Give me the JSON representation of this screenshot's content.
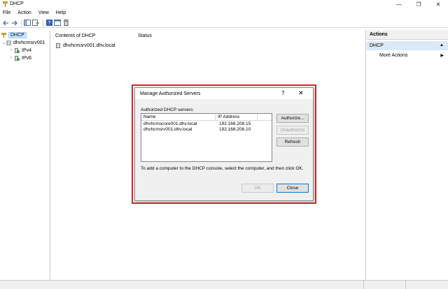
{
  "window": {
    "title": "DHCP",
    "controls": {
      "minimize": "—",
      "maximize": "❐",
      "close": "✕"
    }
  },
  "menu": [
    "File",
    "Action",
    "View",
    "Help"
  ],
  "toolbar": {
    "icons": [
      "back-icon",
      "forward-icon",
      "console-tree-icon",
      "export-list-icon",
      "help-icon",
      "properties-icon",
      "server-icon"
    ]
  },
  "tree": {
    "root": "DHCP",
    "server": "dhvhcmsrv001",
    "children": [
      "IPv4",
      "IPv6"
    ]
  },
  "content": {
    "columns": [
      "Contents of DHCP",
      "Status"
    ],
    "rows": [
      {
        "name": "dhvhcmsrv001.dhv.local",
        "status": ""
      }
    ]
  },
  "actions": {
    "title": "Actions",
    "section": "DHCP",
    "items": [
      "More Actions"
    ]
  },
  "dialog": {
    "title": "Manage Authorized Servers",
    "help": "?",
    "close": "✕",
    "list_label": "Authorized DHCP servers:",
    "columns": [
      "Name",
      "IP Address"
    ],
    "rows": [
      {
        "name": "dhvhcmscore001.dhv.local",
        "ip": "192.168.208.15"
      },
      {
        "name": "dhvhcmsrv001.dhv.local",
        "ip": "192.168.208.10"
      }
    ],
    "buttons": {
      "authorize": "Authorize...",
      "unauthorize": "Unauthorize",
      "refresh": "Refresh",
      "ok": "OK",
      "close": "Close"
    },
    "hint": "To add a computer to the DHCP console, select the computer, and then click OK."
  },
  "colors": {
    "highlight": "#d9252a",
    "selection": "#cce8ff",
    "actions_section": "#dbe8f7",
    "dialog_bg": "#f0f0f0"
  }
}
